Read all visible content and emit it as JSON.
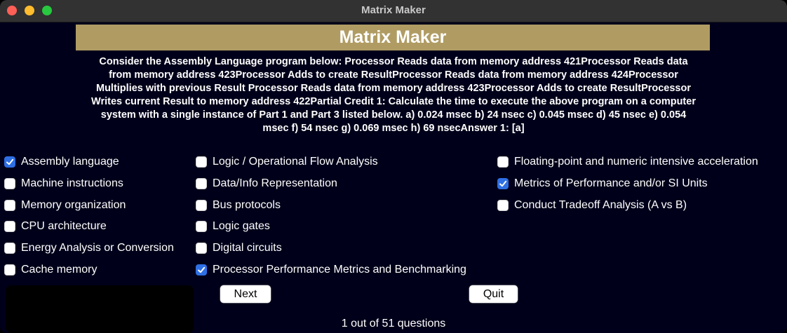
{
  "window": {
    "title": "Matrix Maker"
  },
  "banner": {
    "title": "Matrix Maker"
  },
  "question": {
    "text": "Consider the Assembly Language program below: Processor Reads data from memory address 421Processor Reads data from memory address 423Processor Adds to create ResultProcessor Reads data from memory address 424Processor Multiplies with previous Result Processor Reads data from memory address 423Processor Adds to create ResultProcessor Writes current Result to memory address 422Partial Credit 1: Calculate the time to execute the above program on a computer system with a single instance of Part 1 and Part 3 listed below. a) 0.024 msec b) 24 nsec c) 0.045 msec d) 45 nsec e) 0.054 msec f) 54 nsec g) 0.069 msec h) 69 nsecAnswer 1: [a]"
  },
  "checkboxes": [
    {
      "label": "Assembly language",
      "checked": true
    },
    {
      "label": "Machine instructions",
      "checked": false
    },
    {
      "label": "Memory organization",
      "checked": false
    },
    {
      "label": "CPU architecture",
      "checked": false
    },
    {
      "label": "Energy Analysis or Conversion",
      "checked": false
    },
    {
      "label": "Cache memory",
      "checked": false
    },
    {
      "label": "Logic / Operational Flow Analysis",
      "checked": false
    },
    {
      "label": "Data/Info Representation",
      "checked": false
    },
    {
      "label": "Bus protocols",
      "checked": false
    },
    {
      "label": "Logic gates",
      "checked": false
    },
    {
      "label": "Digital circuits",
      "checked": false
    },
    {
      "label": "Processor Performance Metrics and Benchmarking",
      "checked": true
    },
    {
      "label": "Floating-point and numeric intensive acceleration",
      "checked": false
    },
    {
      "label": "Metrics of Performance and/or SI Units",
      "checked": true
    },
    {
      "label": "Conduct Tradeoff Analysis (A vs B)",
      "checked": false
    }
  ],
  "buttons": {
    "next": "Next",
    "quit": "Quit"
  },
  "status": {
    "text": "1 out of 51 questions"
  },
  "colors": {
    "banner": "#b09c63",
    "checkbox_checked": "#2f6fe4",
    "background": "#00001a"
  }
}
